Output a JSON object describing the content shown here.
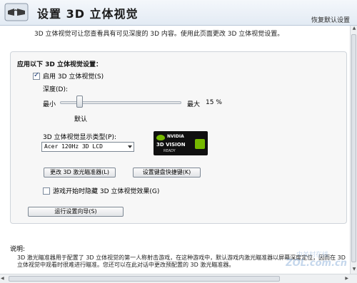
{
  "header": {
    "title": "设置 3D 立体视觉",
    "restore_defaults": "恢复默认设置"
  },
  "intro": "3D 立体视觉可让您查看具有可见深度的 3D 内容。使用此页面更改 3D 立体视觉设置。",
  "panel": {
    "title": "应用以下 3D 立体视觉设置：",
    "enable_label": "启用 3D 立体视觉(S)",
    "enable_checked": true,
    "depth_label": "深度(D):",
    "min_label": "最小",
    "max_label": "最大",
    "depth_percent": "15 %",
    "depth_value_percent": 15,
    "default_label": "默认",
    "display_type_label": "3D 立体视觉显示类型(P):",
    "display_type_value": "Acer 120Hz 3D LCD",
    "badge": {
      "brand": "NVIDIA",
      "product": "3D VISION",
      "status": "READY"
    },
    "change_laser_button": "更改 3D 激光瞄准器(L)",
    "hotkeys_button": "设置键盘快捷键(K)",
    "hide_effect_label": "游戏开始时隐藏 3D 立体视觉效果(G)",
    "hide_effect_checked": false,
    "wizard_button": "运行设置向导(S)"
  },
  "description": {
    "heading": "说明:",
    "text": "3D 激光瞄准器用于配置了 3D 立体视觉的第一人称射击游戏，在这种游戏中，默认游戏内激光瞄准器以屏幕深度定位，因而在 3D 立体视觉中观看时很难进行瞄准。您还可以在此对话中更改预配置的 3D 激光瞄准器。"
  },
  "watermark": {
    "cn": "中关村在线",
    "en": "ZOL.com.cn"
  },
  "colors": {
    "nvidia_green": "#76b900",
    "header_bg": "#e3ebf4"
  }
}
